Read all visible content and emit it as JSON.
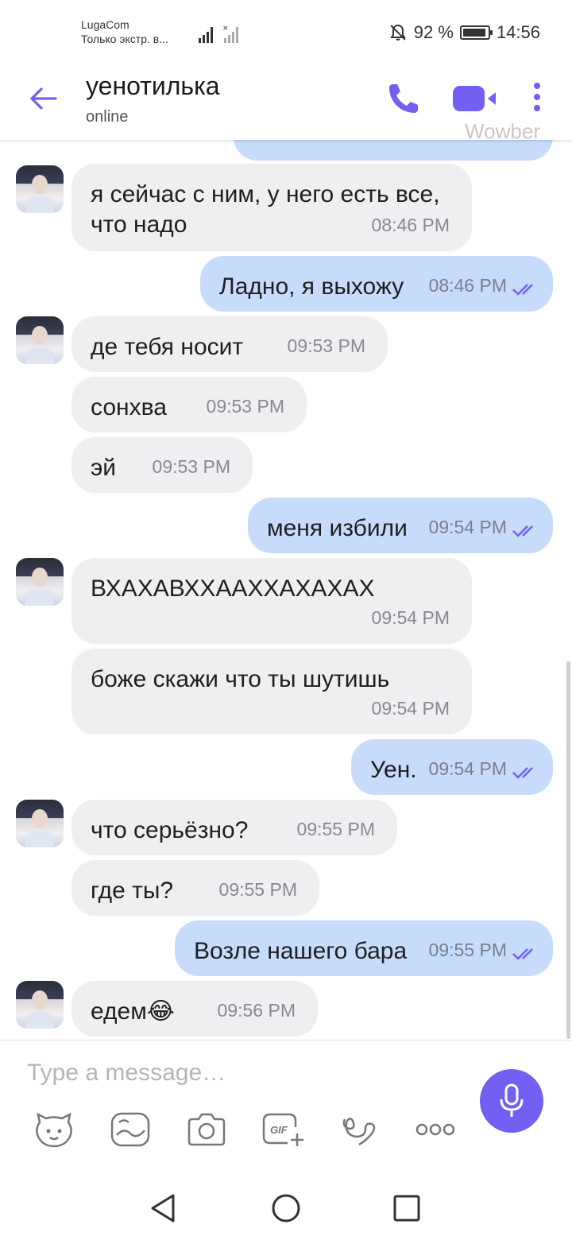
{
  "status_bar": {
    "carrier": "LugaCom",
    "carrier_sub": "Только экстр. в...",
    "battery_percent": "92 %",
    "battery_level": 0.92,
    "time": "14:56"
  },
  "header": {
    "contact_name": "уенотилька",
    "status": "online",
    "watermark": "Wowber"
  },
  "messages": [
    {
      "dir": "in",
      "text": "я сейчас с ним, у него есть все, что надо",
      "time": "08:46 PM"
    },
    {
      "dir": "out",
      "text": "Ладно, я выхожу",
      "time": "08:46 PM"
    },
    {
      "dir": "in",
      "text": "де тебя носит",
      "time": "09:53 PM"
    },
    {
      "dir": "in",
      "text": "сонхва",
      "time": "09:53 PM"
    },
    {
      "dir": "in",
      "text": "эй",
      "time": "09:53 PM"
    },
    {
      "dir": "out",
      "text": "меня избили",
      "time": "09:54 PM"
    },
    {
      "dir": "in",
      "text": "ВХАХАВХХААХХАХАХАХ",
      "time": "09:54 PM"
    },
    {
      "dir": "in",
      "text": "боже скажи что ты шутишь",
      "time": "09:54 PM"
    },
    {
      "dir": "out",
      "text": "Уен.",
      "time": "09:54 PM"
    },
    {
      "dir": "in",
      "text": "что серьёзно?",
      "time": "09:55 PM"
    },
    {
      "dir": "in",
      "text": "где ты?",
      "time": "09:55 PM"
    },
    {
      "dir": "out",
      "text": "Возле нашего бара",
      "time": "09:55 PM"
    },
    {
      "dir": "in",
      "text": "едем😂",
      "time": "09:56 PM"
    }
  ],
  "composer": {
    "placeholder": "Type a message…"
  },
  "colors": {
    "accent": "#7360f2",
    "incoming_bubble": "#efeef1",
    "outgoing_bubble": "#c7dcfb"
  },
  "icons": [
    "back-arrow-icon",
    "phone-icon",
    "video-camera-icon",
    "more-vertical-icon",
    "sticker-icon",
    "doodle-icon",
    "camera-icon",
    "gif-icon",
    "scribble-icon",
    "more-horizontal-icon",
    "microphone-icon",
    "nav-back-icon",
    "nav-home-icon",
    "nav-recents-icon"
  ]
}
